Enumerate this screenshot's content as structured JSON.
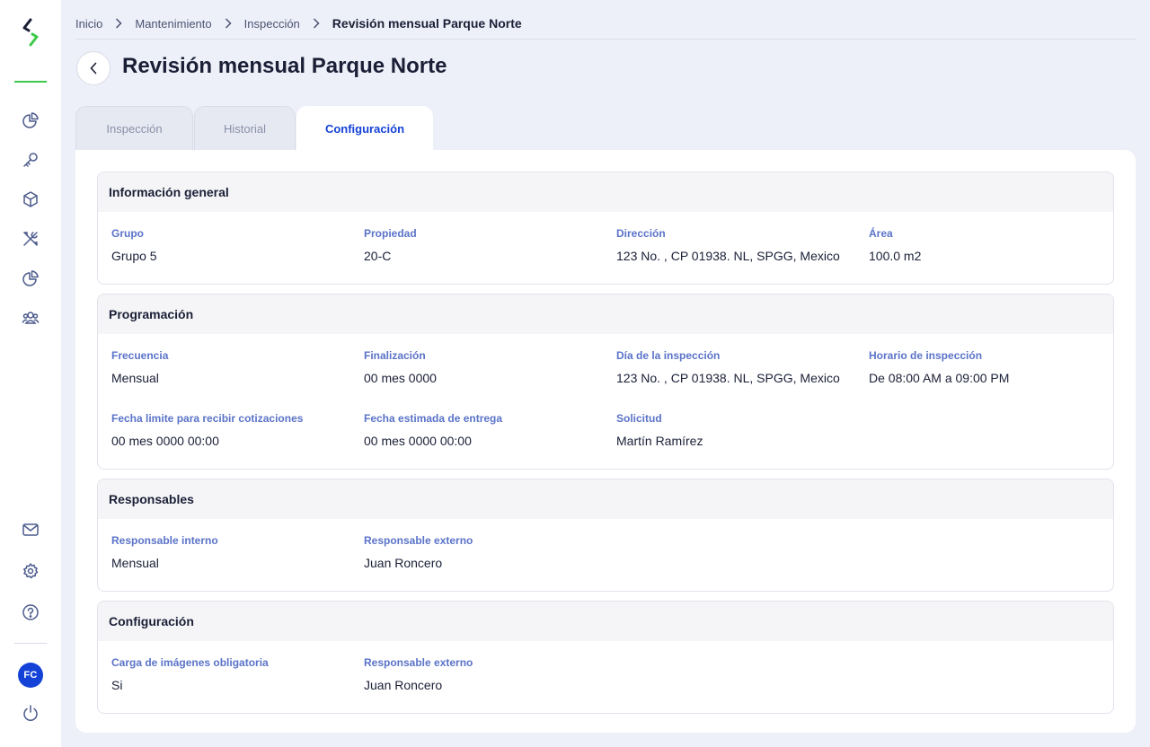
{
  "breadcrumb": {
    "items": [
      "Inicio",
      "Mantenimiento",
      "Inspección"
    ],
    "current": "Revisión mensual Parque Norte"
  },
  "page": {
    "title": "Revisión mensual Parque Norte"
  },
  "tabs": [
    {
      "label": "Inspección",
      "active": false
    },
    {
      "label": "Historial",
      "active": false
    },
    {
      "label": "Configuración",
      "active": true
    }
  ],
  "sidebar": {
    "icons": [
      "pie-chart-icon",
      "key-icon",
      "cube-icon",
      "tools-icon",
      "pie-chart-icon",
      "users-icon"
    ],
    "bottom_icons": [
      "mail-icon",
      "gear-icon",
      "help-icon"
    ],
    "avatar_initials": "FC",
    "logout_icon": "power-icon"
  },
  "sections": {
    "general": {
      "title": "Información general",
      "fields": [
        {
          "label": "Grupo",
          "value": "Grupo 5"
        },
        {
          "label": "Propiedad",
          "value": "20-C"
        },
        {
          "label": "Dirección",
          "value": "123 No. , CP 01938. NL, SPGG, Mexico"
        },
        {
          "label": "Área",
          "value": "100.0 m2"
        }
      ]
    },
    "programacion": {
      "title": "Programación",
      "fields": [
        {
          "label": "Frecuencia",
          "value": "Mensual"
        },
        {
          "label": "Finalización",
          "value": "00 mes 0000"
        },
        {
          "label": "Día de la inspección",
          "value": "123 No. , CP 01938. NL, SPGG, Mexico"
        },
        {
          "label": "Horario de inspección",
          "value": "De 08:00 AM a 09:00 PM"
        },
        {
          "label": "Fecha limite para recibir cotizaciones",
          "value": "00 mes 0000 00:00"
        },
        {
          "label": "Fecha estimada de entrega",
          "value": "00 mes 0000 00:00"
        },
        {
          "label": "Solicitud",
          "value": "Martín Ramírez"
        }
      ]
    },
    "responsables": {
      "title": "Responsables",
      "fields": [
        {
          "label": "Responsable interno",
          "value": "Mensual"
        },
        {
          "label": "Responsable externo",
          "value": "Juan Roncero"
        }
      ]
    },
    "configuracion": {
      "title": "Configuración",
      "fields": [
        {
          "label": "Carga de imágenes obligatoria",
          "value": "Si"
        },
        {
          "label": "Responsable externo",
          "value": "Juan Roncero"
        }
      ]
    }
  },
  "colors": {
    "accent": "#1442d6",
    "label": "#5a73c8",
    "logo_green": "#3ec94a",
    "background": "#eef0f9"
  }
}
